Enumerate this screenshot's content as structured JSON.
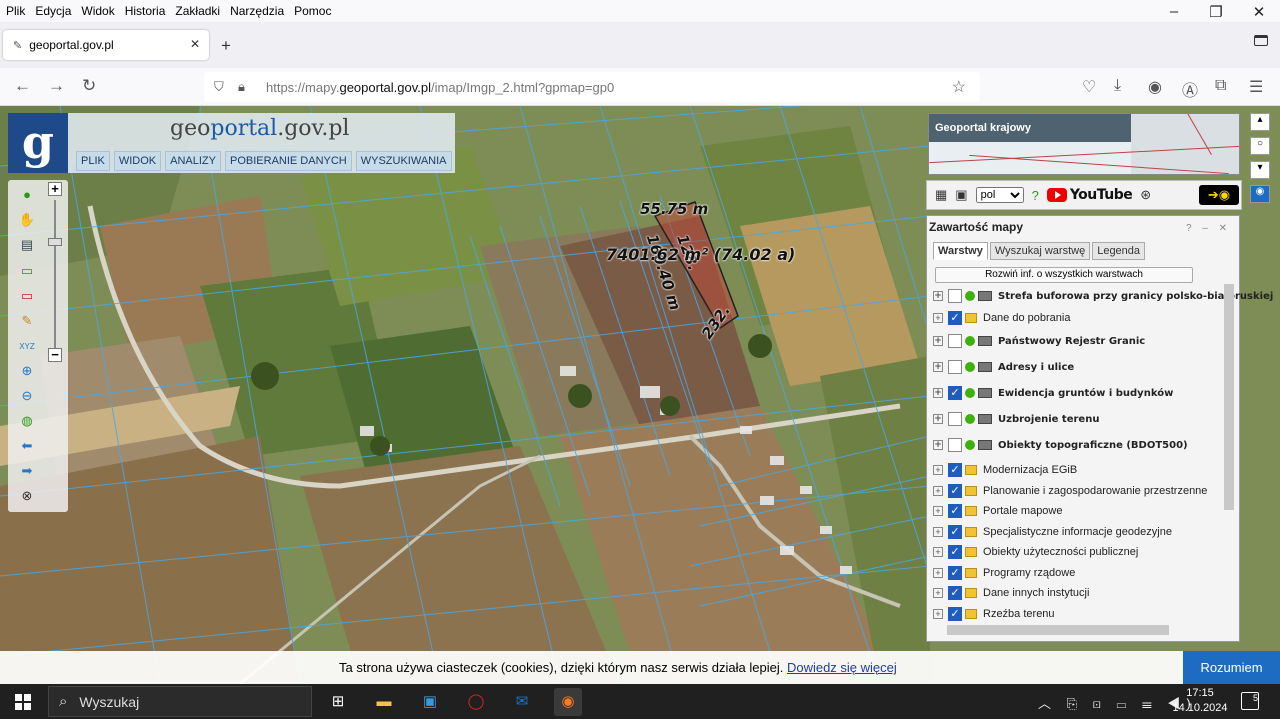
{
  "browser_menu": [
    "Plik",
    "Edycja",
    "Widok",
    "Historia",
    "Zakładki",
    "Narzędzia",
    "Pomoc"
  ],
  "tab": {
    "title": "geoportal.gov.pl"
  },
  "url": {
    "prefix": "https://mapy.",
    "host": "geoportal.gov.pl",
    "path": "/imap/Imgp_2.html?gpmap=gp0"
  },
  "site": {
    "logo_prefix": "geo",
    "logo_accent": "portal",
    "logo_suffix": ".gov.pl",
    "logo_letter": "g"
  },
  "main_menu": [
    "PLIK",
    "WIDOK",
    "ANALIZY",
    "POBIERANIE DANYCH",
    "WYSZUKIWANIA"
  ],
  "overview": {
    "label": "Geoportal krajowy"
  },
  "topbar": {
    "language": "pol",
    "youtube": "YouTube"
  },
  "measurements": {
    "side1": "55.75 m",
    "side2": "128.",
    "side3": "160.40 m",
    "side4": "232.",
    "area": "7401.62 m² (74.02 a)"
  },
  "layer_panel": {
    "title": "Zawartość mapy",
    "tabs": [
      "Warstwy",
      "Wyszukaj warstwę",
      "Legenda"
    ],
    "expand_all": "Rozwiń inf. o wszystkich warstwach",
    "layers": [
      {
        "label": "Strefa buforowa przy granicy polsko-białoruskiej",
        "checked": false,
        "type": "service"
      },
      {
        "label": "Dane do pobrania",
        "checked": true,
        "type": "folder"
      },
      {
        "label": "Państwowy Rejestr Granic",
        "checked": false,
        "type": "service"
      },
      {
        "label": "Adresy i ulice",
        "checked": false,
        "type": "service"
      },
      {
        "label": "Ewidencja gruntów i budynków",
        "checked": true,
        "type": "service"
      },
      {
        "label": "Uzbrojenie terenu",
        "checked": false,
        "type": "service"
      },
      {
        "label": "Obiekty topograficzne (BDOT500)",
        "checked": false,
        "type": "service"
      },
      {
        "label": "Modernizacja EGiB",
        "checked": true,
        "type": "folder"
      },
      {
        "label": "Planowanie i zagospodarowanie przestrzenne",
        "checked": true,
        "type": "folder"
      },
      {
        "label": "Portale mapowe",
        "checked": true,
        "type": "folder"
      },
      {
        "label": "Specjalistyczne informacje geodezyjne",
        "checked": true,
        "type": "folder"
      },
      {
        "label": "Obiekty użyteczności publicznej",
        "checked": true,
        "type": "folder"
      },
      {
        "label": "Programy rządowe",
        "checked": true,
        "type": "folder"
      },
      {
        "label": "Dane innych instytucji",
        "checked": true,
        "type": "folder"
      },
      {
        "label": "Rzeźba terenu",
        "checked": true,
        "type": "folder"
      }
    ]
  },
  "cookie": {
    "text": "Ta strona używa ciasteczek (cookies), dzięki którym nasz serwis działa lepiej. ",
    "link": "Dowiedz się więcej",
    "accept": "Rozumiem"
  },
  "taskbar": {
    "search": "Wyszukaj",
    "time": "17:15",
    "date": "14.10.2024",
    "notifications": "5"
  },
  "colors": {
    "accent": "#1e6bc2",
    "logo_bg": "#1f4a8a",
    "check": "#1e5dbe"
  }
}
